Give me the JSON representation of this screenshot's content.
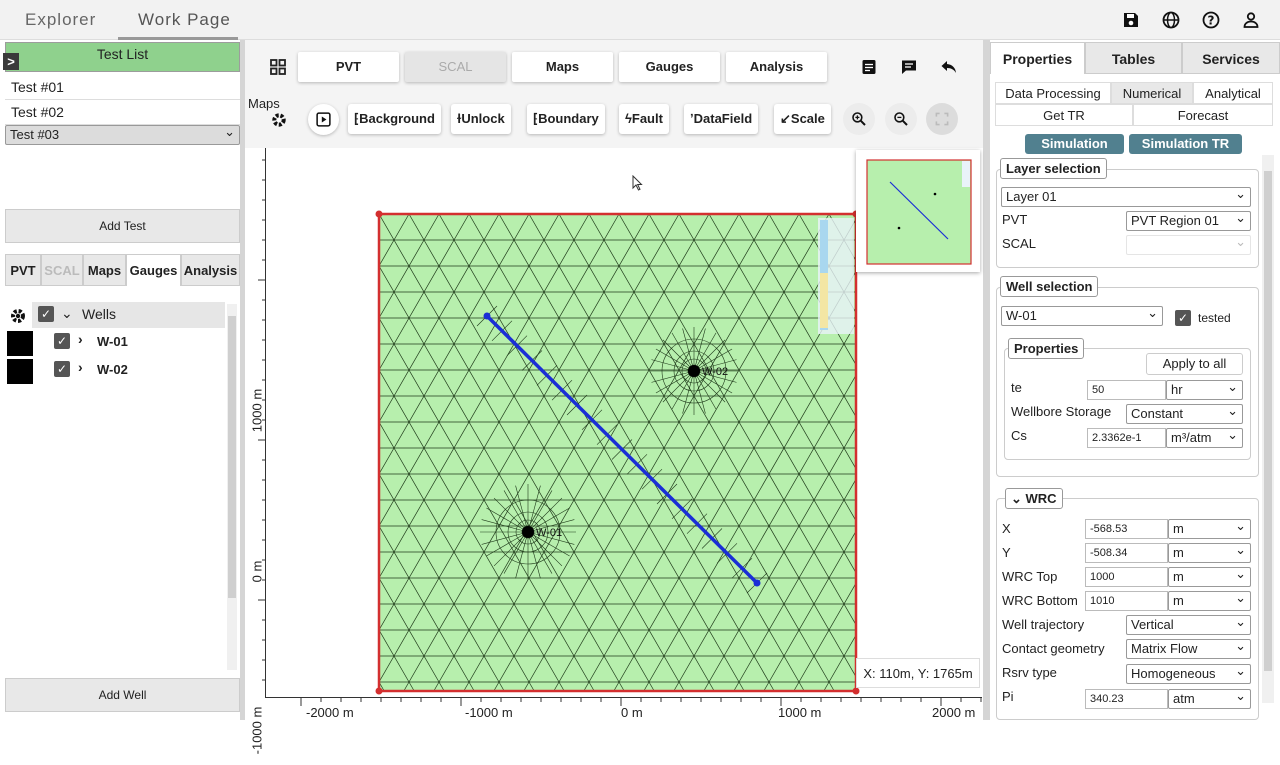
{
  "header": {
    "tabs": [
      "Explorer",
      "Work Page"
    ],
    "icons": [
      "save-icon",
      "globe-icon",
      "help-icon",
      "user-icon"
    ]
  },
  "left": {
    "expand_glyph": ">",
    "test_list_title": "Test List",
    "tests": [
      "Test #01",
      "Test #02",
      "Test #03"
    ],
    "selected_test": "Test #03",
    "add_test": "Add Test",
    "tabs": [
      "PVT",
      "SCAL",
      "Maps",
      "Gauges",
      "Analysis"
    ],
    "active_tab": "Gauges",
    "wells_root": "Wells",
    "wells": [
      "W-01",
      "W-02"
    ],
    "add_well": "Add Well"
  },
  "center": {
    "tabs": [
      "PVT",
      "SCAL",
      "Maps",
      "Gauges",
      "Analysis"
    ],
    "disabled_tab": "SCAL",
    "tooltip": "Maps",
    "toolbar": [
      "Background",
      "Unlock",
      "Boundary",
      "Fault",
      "DataField",
      "Scale"
    ],
    "x_ticks": [
      "-2000 m",
      "-1000 m",
      "0 m",
      "1000 m",
      "2000 m"
    ],
    "y_ticks": [
      "1000 m",
      "0 m",
      "-1000 m"
    ],
    "well_labels": [
      "W-02",
      "W-01"
    ],
    "coords": "X: 110m, Y: 1765m",
    "colors": {
      "grid_fill": "#b7efad",
      "boundary": "#d32f2f",
      "fault": "#1a2ed6"
    }
  },
  "right": {
    "tabs": [
      "Properties",
      "Tables",
      "Services"
    ],
    "active_tab": "Properties",
    "subtabs_row1": [
      "Data Processing",
      "Numerical",
      "Analytical"
    ],
    "active_subtab": "Numerical",
    "subtabs_row2": [
      "Get TR",
      "Forecast"
    ],
    "sim_buttons": [
      "Simulation",
      "Simulation TR"
    ],
    "layer_selection": {
      "legend": "Layer selection",
      "layer": "Layer 01",
      "pvt_label": "PVT",
      "pvt_value": "PVT Region 01",
      "scal_label": "SCAL",
      "scal_value": ""
    },
    "well_selection": {
      "legend": "Well selection",
      "well": "W-01",
      "tested_label": "tested",
      "properties_legend": "Properties",
      "apply_all": "Apply to all",
      "te_label": "te",
      "te_value": "50",
      "te_unit": "hr",
      "wbs_label": "Wellbore Storage",
      "wbs_value": "Constant",
      "cs_label": "Cs",
      "cs_value": "2.3362e-1",
      "cs_unit": "m³/atm"
    },
    "wrc": {
      "legend": "WRC",
      "x_label": "X",
      "x_value": "-568.53",
      "x_unit": "m",
      "y_label": "Y",
      "y_value": "-508.34",
      "y_unit": "m",
      "top_label": "WRC Top",
      "top_value": "1000",
      "top_unit": "m",
      "bottom_label": "WRC Bottom",
      "bottom_value": "1010",
      "bottom_unit": "m",
      "traj_label": "Well trajectory",
      "traj_value": "Vertical",
      "contact_label": "Contact geometry",
      "contact_value": "Matrix Flow",
      "rsrv_label": "Rsrv type",
      "rsrv_value": "Homogeneous",
      "pi_label": "Pi",
      "pi_value": "340.23",
      "pi_unit": "atm"
    }
  }
}
